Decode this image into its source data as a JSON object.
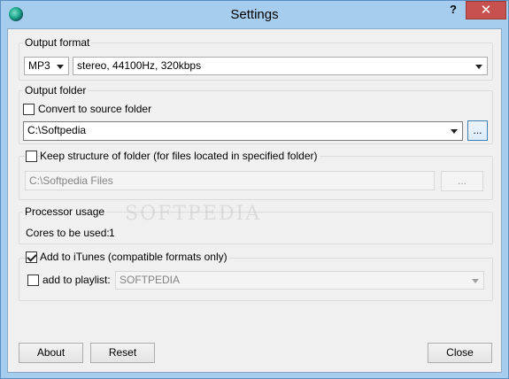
{
  "window": {
    "title": "Settings",
    "help_button": "?",
    "close_button": "✕"
  },
  "output_format": {
    "group_label": "Output format",
    "format_value": "MP3",
    "quality_value": "stereo, 44100Hz, 320kbps"
  },
  "output_folder": {
    "group_label": "Output folder",
    "convert_to_source_label": "Convert to source folder",
    "convert_to_source_checked": false,
    "folder_value": "C:\\Softpedia",
    "browse_label": "..."
  },
  "keep_structure": {
    "label": "Keep structure of folder (for files located in specified folder)",
    "checked": false,
    "folder_value": "C:\\Softpedia Files",
    "browse_label": "..."
  },
  "processor": {
    "group_label": "Processor usage",
    "cores_label": "Cores to be used:",
    "cores_value": "1"
  },
  "itunes": {
    "add_label": "Add to iTunes (compatible formats only)",
    "add_checked": true,
    "playlist_label": "add to playlist:",
    "playlist_checked": false,
    "playlist_value": "SOFTPEDIA"
  },
  "buttons": {
    "about": "About",
    "reset": "Reset",
    "close": "Close"
  },
  "watermark": "SOFTPEDIA"
}
